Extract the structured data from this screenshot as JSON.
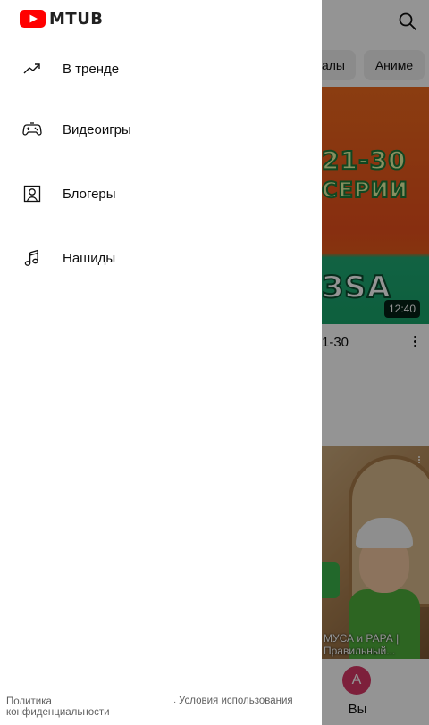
{
  "drawer": {
    "brand": "MTUB",
    "items": [
      {
        "label": "В тренде",
        "icon": "trending-icon"
      },
      {
        "label": "Видеоигры",
        "icon": "gamepad-icon"
      },
      {
        "label": "Блогеры",
        "icon": "person-icon"
      },
      {
        "label": "Нашиды",
        "icon": "music-note-icon"
      }
    ],
    "footer": {
      "privacy": "Политика конфиденциальности",
      "separator": "·",
      "terms": "Условия использования"
    }
  },
  "background": {
    "chips": [
      "алы",
      "Аниме"
    ],
    "video1": {
      "thumb_text_1": "21-30",
      "thumb_text_2": "СЕРИИ",
      "thumb_text_3": "ЗSA",
      "duration": "12:40",
      "title": "1-30"
    },
    "video2": {
      "caption": "МУСА и РАРА | Правильный..."
    },
    "bottom_nav": {
      "avatar_letter": "A",
      "you_label": "Вы"
    }
  },
  "colors": {
    "brand_red": "#ff0000",
    "avatar": "#d73866",
    "scrim": "rgba(0,0,0,0.42)"
  }
}
